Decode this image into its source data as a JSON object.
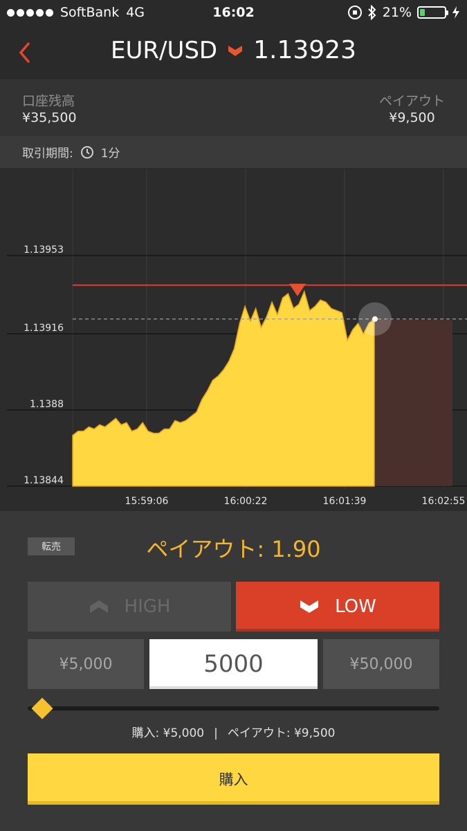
{
  "status_bar": {
    "carrier": "SoftBank",
    "network": "4G",
    "time": "16:02",
    "battery": "21%",
    "battery_level": 0.21
  },
  "header": {
    "pair": "EUR/USD",
    "rate": "1.13923",
    "direction_icon": "down-chevron-icon"
  },
  "account": {
    "balance_label": "口座残高",
    "balance_value": "¥35,500",
    "payout_label": "ペイアウト",
    "payout_value": "¥9,500"
  },
  "period": {
    "label": "取引期間:",
    "value": "1分"
  },
  "colors": {
    "accent": "#f5b62d",
    "low": "#d94027",
    "chart_fill": "#ffd740",
    "strike_line": "#e53935"
  },
  "chart_data": {
    "type": "area",
    "x_ticks": [
      "15:59:06",
      "16:00:22",
      "16:01:39",
      "16:02:55"
    ],
    "y_ticks": [
      1.13953,
      1.13916,
      1.1388,
      1.13844
    ],
    "ylim": [
      1.13844,
      1.13953
    ],
    "strike": 1.13939,
    "current": 1.13923,
    "series": [
      {
        "values": [
          1.13868,
          1.1387,
          1.1387,
          1.13872,
          1.13871,
          1.13873,
          1.13872,
          1.13874,
          1.13876,
          1.13873,
          1.13874,
          1.1387,
          1.13871,
          1.13874,
          1.1387,
          1.13869,
          1.13869,
          1.13871,
          1.13871,
          1.13875,
          1.13874,
          1.13875,
          1.13877,
          1.13879,
          1.13885,
          1.13889,
          1.13894,
          1.13896,
          1.13899,
          1.13903,
          1.13909,
          1.13921,
          1.13929,
          1.13922,
          1.13928,
          1.13919,
          1.13924,
          1.13931,
          1.13925,
          1.13933,
          1.13935,
          1.13928,
          1.1393,
          1.13936,
          1.13927,
          1.13929,
          1.13932,
          1.13931,
          1.13928,
          1.13927,
          1.13926,
          1.13913,
          1.13918,
          1.13921,
          1.13916,
          1.13921,
          1.13923
        ]
      }
    ]
  },
  "panel": {
    "resell_label": "転売",
    "payout_rate": "ペイアウト: 1.90",
    "high_label": "HIGH",
    "low_label": "LOW",
    "amount_min": "¥5,000",
    "amount_value": "5000",
    "amount_max": "¥50,000",
    "slider_fraction": 0.0,
    "summary_purchase": "購入: ¥5,000",
    "summary_separator": "|",
    "summary_payout": "ペイアウト: ¥9,500",
    "buy_label": "購入"
  }
}
